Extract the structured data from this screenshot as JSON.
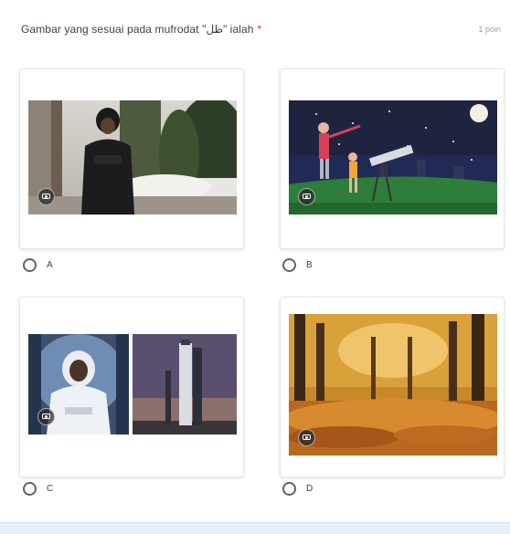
{
  "question": {
    "text": "Gambar yang sesuai pada mufrodat \"ﻇﻞ\" ialah",
    "required_mark": "*",
    "points": "1 poin"
  },
  "options": [
    {
      "label": "A",
      "image": "man-in-black-coat-winter-park-photo"
    },
    {
      "label": "B",
      "image": "night-sky-telescope-illustration"
    },
    {
      "label": "C",
      "image": "astronaut-and-rocket-photo"
    },
    {
      "label": "D",
      "image": "autumn-trees-fallen-leaves-photo"
    }
  ],
  "icons": {
    "image_badge": "camera-icon"
  },
  "colors": {
    "required": "#d93025",
    "radio_border": "#5f6368",
    "accent_bar": "#e8f0fe"
  }
}
